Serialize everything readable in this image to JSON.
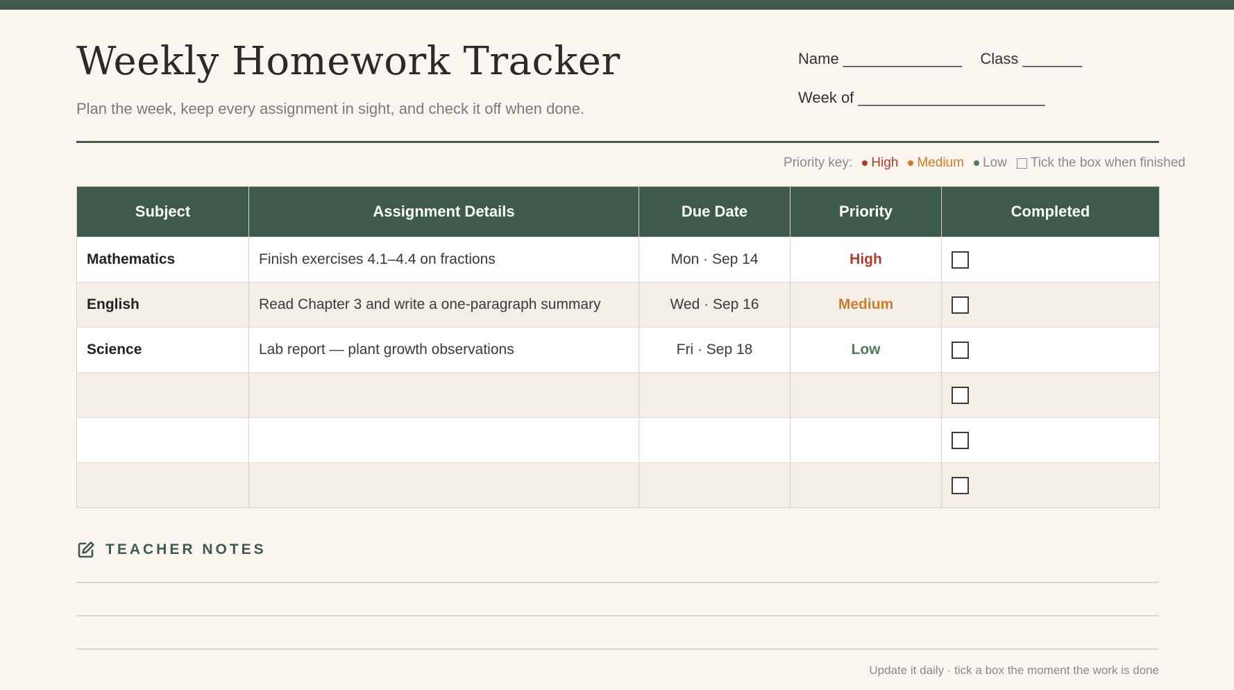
{
  "header": {
    "title": "Weekly Homework Tracker",
    "subtitle": "Plan the week, keep every assignment in sight, and check it off when done.",
    "name_label": "Name",
    "name_blank": "______________",
    "class_label": "Class",
    "class_blank": "_______",
    "week_label": "Week of",
    "week_blank": "______________________"
  },
  "priority_key": {
    "label": "Priority key:",
    "high": "High",
    "medium": "Medium",
    "low": "Low",
    "checkbox_hint": "Tick the box when finished"
  },
  "table": {
    "columns": [
      "Subject",
      "Assignment Details",
      "Due Date",
      "Priority",
      "Completed"
    ],
    "rows": [
      {
        "subject": "Mathematics",
        "details": "Finish exercises 4.1–4.4 on fractions",
        "due": "Mon · Sep 14",
        "priority": "High",
        "completed": false
      },
      {
        "subject": "English",
        "details": "Read Chapter 3 and write a one-paragraph summary",
        "due": "Wed · Sep 16",
        "priority": "Medium",
        "completed": false
      },
      {
        "subject": "Science",
        "details": "Lab report — plant growth observations",
        "due": "Fri · Sep 18",
        "priority": "Low",
        "completed": false
      },
      {
        "subject": "",
        "details": "",
        "due": "",
        "priority": "",
        "completed": false
      },
      {
        "subject": "",
        "details": "",
        "due": "",
        "priority": "",
        "completed": false
      },
      {
        "subject": "",
        "details": "",
        "due": "",
        "priority": "",
        "completed": false
      }
    ]
  },
  "notes": {
    "icon": "edit-icon",
    "title": "TEACHER NOTES"
  },
  "footer": "Update it daily · tick a box the moment the work is done",
  "colors": {
    "accent": "#3e5a4c",
    "high": "#b03a2e",
    "medium": "#d07a2c",
    "low": "#4f7a5a"
  }
}
